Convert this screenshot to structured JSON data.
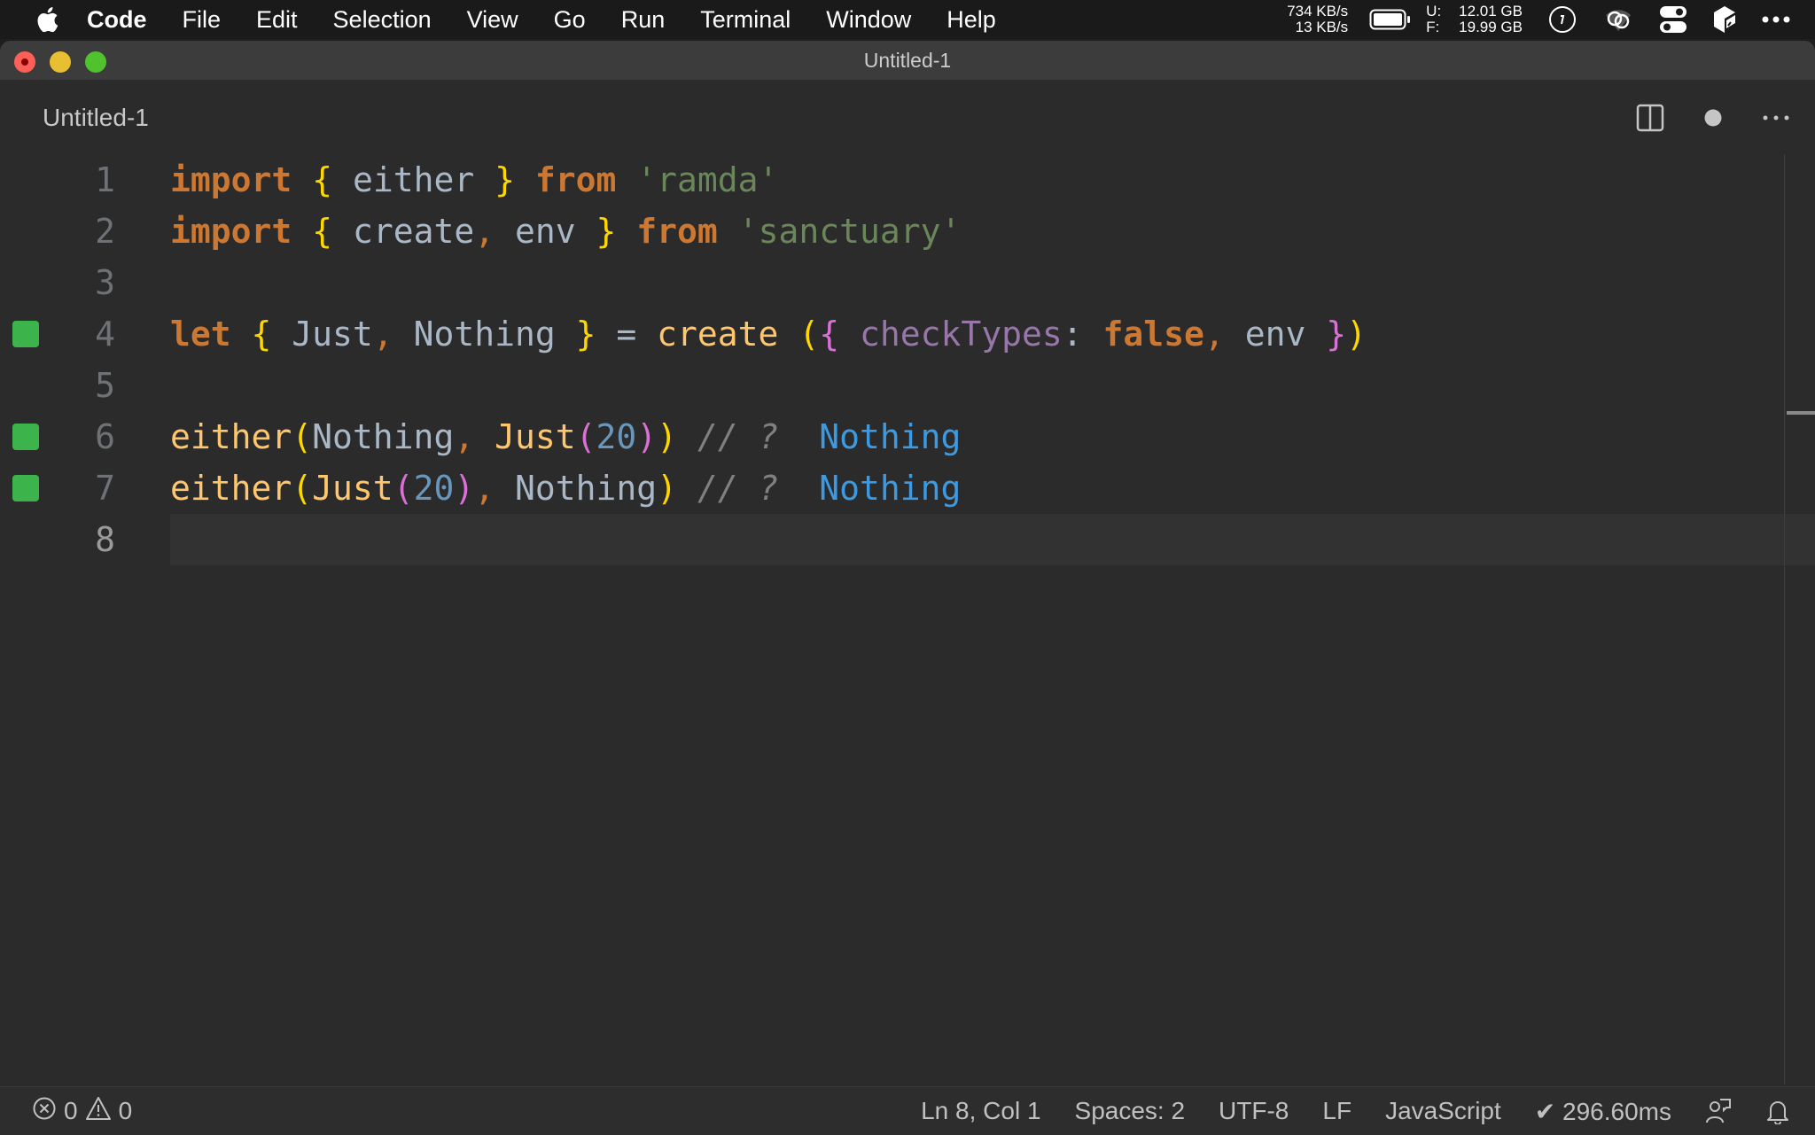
{
  "menubar": {
    "app": "Code",
    "items": [
      "File",
      "Edit",
      "Selection",
      "View",
      "Go",
      "Run",
      "Terminal",
      "Window",
      "Help"
    ],
    "net_up": "734 KB/s",
    "net_down": "13 KB/s",
    "disk_used_label": "U:",
    "disk_used": "12.01 GB",
    "disk_free_label": "F:",
    "disk_free": "19.99 GB"
  },
  "window": {
    "title": "Untitled-1"
  },
  "tab": {
    "label": "Untitled-1",
    "dirty": true
  },
  "editor": {
    "current_line": 8,
    "lines": [
      {
        "n": "1",
        "mark": false,
        "tokens": [
          [
            "kw",
            "import"
          ],
          [
            "id",
            " "
          ],
          [
            "br1",
            "{"
          ],
          [
            "id",
            " either "
          ],
          [
            "br1",
            "}"
          ],
          [
            "id",
            " "
          ],
          [
            "kw",
            "from"
          ],
          [
            "id",
            " "
          ],
          [
            "str",
            "'ramda'"
          ]
        ]
      },
      {
        "n": "2",
        "mark": false,
        "tokens": [
          [
            "kw",
            "import"
          ],
          [
            "id",
            " "
          ],
          [
            "br1",
            "{"
          ],
          [
            "id",
            " create"
          ],
          [
            "punc",
            ","
          ],
          [
            "id",
            " env "
          ],
          [
            "br1",
            "}"
          ],
          [
            "id",
            " "
          ],
          [
            "kw",
            "from"
          ],
          [
            "id",
            " "
          ],
          [
            "str",
            "'sanctuary'"
          ]
        ]
      },
      {
        "n": "3",
        "mark": false,
        "tokens": []
      },
      {
        "n": "4",
        "mark": true,
        "tokens": [
          [
            "kw",
            "let"
          ],
          [
            "id",
            " "
          ],
          [
            "br1",
            "{"
          ],
          [
            "id",
            " Just"
          ],
          [
            "punc",
            ","
          ],
          [
            "id",
            " Nothing "
          ],
          [
            "br1",
            "}"
          ],
          [
            "id",
            " = "
          ],
          [
            "fn",
            "create"
          ],
          [
            "id",
            " "
          ],
          [
            "br1",
            "("
          ],
          [
            "br2",
            "{"
          ],
          [
            "id",
            " "
          ],
          [
            "prop",
            "checkTypes"
          ],
          [
            "id",
            ": "
          ],
          [
            "kw",
            "false"
          ],
          [
            "punc",
            ","
          ],
          [
            "id",
            " env "
          ],
          [
            "br2",
            "}"
          ],
          [
            "br1",
            ")"
          ]
        ]
      },
      {
        "n": "5",
        "mark": false,
        "tokens": []
      },
      {
        "n": "6",
        "mark": true,
        "tokens": [
          [
            "fn",
            "either"
          ],
          [
            "br1",
            "("
          ],
          [
            "id",
            "Nothing"
          ],
          [
            "punc",
            ","
          ],
          [
            "id",
            " "
          ],
          [
            "fn",
            "Just"
          ],
          [
            "br2",
            "("
          ],
          [
            "num",
            "20"
          ],
          [
            "br2",
            ")"
          ],
          [
            "br1",
            ")"
          ],
          [
            "id",
            " "
          ],
          [
            "cm",
            "// ?"
          ],
          [
            "id",
            "  "
          ],
          [
            "res",
            "Nothing"
          ]
        ]
      },
      {
        "n": "7",
        "mark": true,
        "tokens": [
          [
            "fn",
            "either"
          ],
          [
            "br1",
            "("
          ],
          [
            "fn",
            "Just"
          ],
          [
            "br2",
            "("
          ],
          [
            "num",
            "20"
          ],
          [
            "br2",
            ")"
          ],
          [
            "punc",
            ","
          ],
          [
            "id",
            " Nothing"
          ],
          [
            "br1",
            ")"
          ],
          [
            "id",
            " "
          ],
          [
            "cm",
            "// ?"
          ],
          [
            "id",
            "  "
          ],
          [
            "res",
            "Nothing"
          ]
        ]
      },
      {
        "n": "8",
        "mark": false,
        "tokens": []
      }
    ]
  },
  "statusbar": {
    "errors": "0",
    "warnings": "0",
    "position": "Ln 8, Col 1",
    "spaces": "Spaces: 2",
    "encoding": "UTF-8",
    "eol": "LF",
    "language": "JavaScript",
    "timing": "✔ 296.60ms"
  }
}
